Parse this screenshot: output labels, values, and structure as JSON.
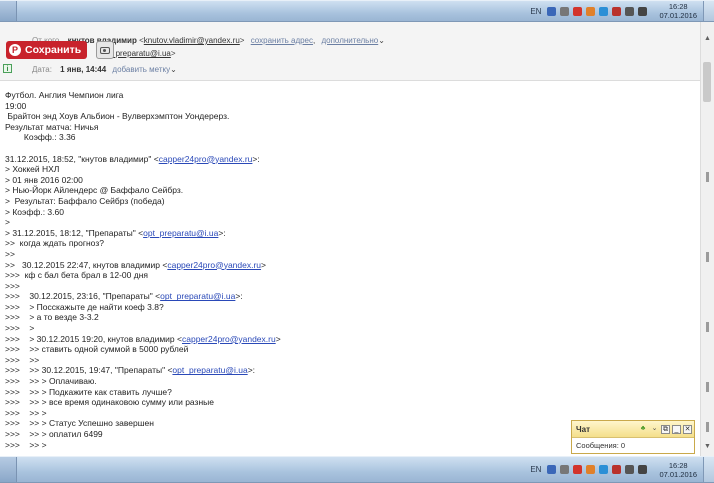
{
  "taskbar": {
    "language": "EN",
    "time": "16:28",
    "date": "07.01.2016"
  },
  "header": {
    "from_label": "От кого",
    "from_name": "кнутов владимир",
    "from_addr": "knutov.vladimir@yandex.ru",
    "save_address": "сохранить адрес",
    "more": "дополнительно",
    "to_addr": "opt_preparatu@i.ua",
    "date_label": "Дата:",
    "date_value": "1 янв, 14:44",
    "add_label": "добавить метку"
  },
  "pinterest": {
    "save_label": "Сохранить"
  },
  "body_lines": [
    [
      "Футбол. Англия Чемпион лига"
    ],
    [
      "19:00"
    ],
    [
      " Брайтон энд Хоув Альбион - Вулверхэмптон Уондерерз."
    ],
    [
      "Результат матча: Ничья"
    ],
    [
      "        Коэфф.: 3.36"
    ],
    [
      ""
    ],
    [
      "31.12.2015, 18:52, \"кнутов владимир\" <",
      {
        "link": "capper24pro@yandex.ru"
      },
      ">:"
    ],
    [
      "> Хоккей НХЛ"
    ],
    [
      "> 01 янв 2016 02:00"
    ],
    [
      "> Нью-Йорк Айлендерс @ Баффало Сейбрз."
    ],
    [
      ">  Результат: Баффало Сейбрз (победа)"
    ],
    [
      "> Коэфф.: 3.60"
    ],
    [
      ">"
    ],
    [
      "> 31.12.2015, 18:12, \"Препараты\" <",
      {
        "link": "opt_preparatu@i.ua"
      },
      ">:"
    ],
    [
      ">>  когда ждать прогноз?"
    ],
    [
      ">>"
    ],
    [
      ">>   30.12.2015 22:47, кнутов владимир <",
      {
        "link": "capper24pro@yandex.ru"
      },
      ">"
    ],
    [
      ">>>  кф с бал бета брал в 12-00 дня"
    ],
    [
      ">>>"
    ],
    [
      ">>>    30.12.2015, 23:16, \"Препараты\" <",
      {
        "link": "opt_preparatu@i.ua"
      },
      ">:"
    ],
    [
      ">>>    > Посскажыте де найти коеф 3.8?"
    ],
    [
      ">>>    > а то везде 3-3.2"
    ],
    [
      ">>>    >"
    ],
    [
      ">>>    > 30.12.2015 19:20, кнутов владимир <",
      {
        "link": "capper24pro@yandex.ru"
      },
      ">"
    ],
    [
      ">>>    >> ставить одной суммой в 5000 рублей"
    ],
    [
      ">>>    >>"
    ],
    [
      ">>>    >> 30.12.2015, 19:47, \"Препараты\" <",
      {
        "link": "opt_preparatu@i.ua"
      },
      ">:"
    ],
    [
      ">>>    >> > Оплачиваю."
    ],
    [
      ">>>    >> > Подкажите как ставить лучше?"
    ],
    [
      ">>>    >> > все время одинаковою сумму или разные"
    ],
    [
      ">>>    >> >"
    ],
    [
      ">>>    >> > Статус Успешно завершен"
    ],
    [
      ">>>    >> > оплатил 6499"
    ],
    [
      ">>>    >> >"
    ]
  ],
  "chat": {
    "title": "Чат",
    "messages": "Сообщения: 0"
  },
  "icons": {
    "pinterest": "pinterest-icon",
    "camera": "camera-icon",
    "info": "info-icon",
    "chevron": "chevron-down-icon"
  },
  "colors": {
    "pinterest_red": "#c8232c",
    "link_blue": "#2a49b8",
    "chat_border": "#c9a94b"
  }
}
